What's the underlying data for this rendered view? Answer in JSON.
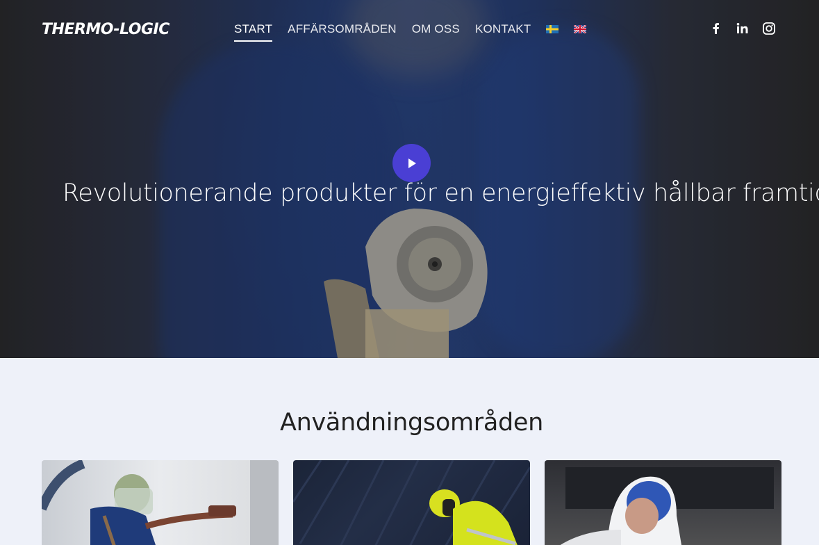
{
  "brand": {
    "logo_text": "THERMO-LOGIC"
  },
  "nav": {
    "items": [
      {
        "label": "START",
        "active": true
      },
      {
        "label": "AFFÄRSOMRÅDEN",
        "active": false
      },
      {
        "label": "OM OSS",
        "active": false
      },
      {
        "label": "KONTAKT",
        "active": false
      }
    ],
    "languages": [
      "swedish-flag-icon",
      "uk-flag-icon"
    ]
  },
  "social": [
    "facebook-icon",
    "linkedin-icon",
    "instagram-icon"
  ],
  "hero": {
    "headline": "Revolutionerande produkter för en energieffektiv hållbar framtid.",
    "play_icon": "play-icon",
    "accent": "#4a3fd4"
  },
  "section": {
    "title": "Användningsområden",
    "cards": [
      "card-spray-insulation",
      "card-roof-worker",
      "card-protective-suit"
    ]
  }
}
